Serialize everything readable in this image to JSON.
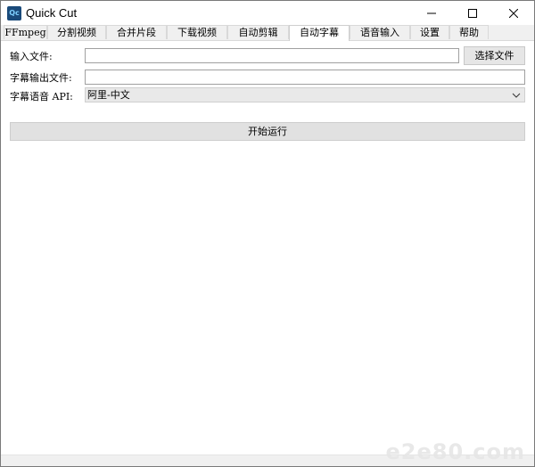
{
  "window": {
    "title": "Quick Cut",
    "logo_text": "Qc"
  },
  "tabs": [
    {
      "label": "FFmpeg",
      "active": false
    },
    {
      "label": "分割视频",
      "active": false
    },
    {
      "label": "合并片段",
      "active": false
    },
    {
      "label": "下载视频",
      "active": false
    },
    {
      "label": "自动剪辑",
      "active": false
    },
    {
      "label": "自动字幕",
      "active": true
    },
    {
      "label": "语音输入",
      "active": false
    },
    {
      "label": "设置",
      "active": false
    },
    {
      "label": "帮助",
      "active": false
    }
  ],
  "form": {
    "input_file_label": "输入文件:",
    "input_file_value": "",
    "choose_file_button": "选择文件",
    "subtitle_output_label": "字幕输出文件:",
    "subtitle_output_value": "",
    "speech_api_label": "字幕语音 API:",
    "speech_api_selected": "阿里-中文",
    "start_button": "开始运行"
  },
  "watermark": "e2e80.com",
  "colors": {
    "logo_bg": "#1a4a7a",
    "window_bg": "#f0f0f0",
    "content_bg": "#ffffff"
  },
  "icons": {
    "minimize": "minimize-icon",
    "maximize": "maximize-icon",
    "close": "close-icon",
    "dropdown": "chevron-down-icon"
  }
}
